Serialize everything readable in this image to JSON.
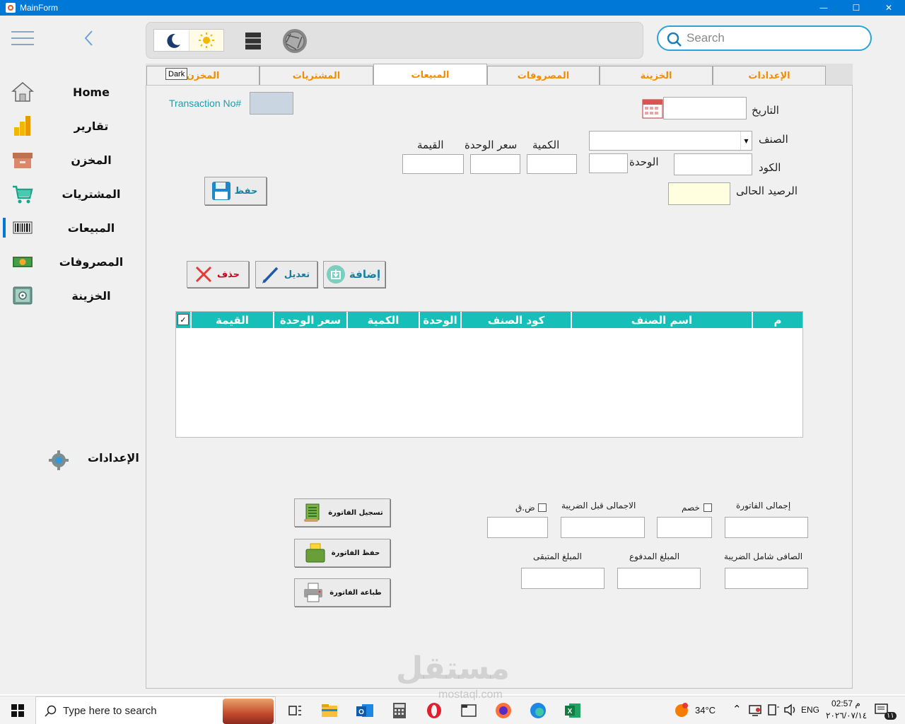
{
  "window": {
    "title": "MainForm",
    "controls": {
      "minimize": "—",
      "maximize": "☐",
      "close": "✕"
    }
  },
  "sidebar": {
    "items": [
      {
        "label": "Home",
        "icon": "home-icon"
      },
      {
        "label": "تقارير",
        "icon": "reports-chart-icon"
      },
      {
        "label": "المخزن",
        "icon": "storage-box-icon"
      },
      {
        "label": "المشتريات",
        "icon": "cart-icon"
      },
      {
        "label": "المبيعات",
        "icon": "barcode-icon",
        "active": true
      },
      {
        "label": "المصروفات",
        "icon": "money-icon"
      },
      {
        "label": "الخزينة",
        "icon": "safe-icon"
      }
    ],
    "settings_label": "الإعدادات"
  },
  "search": {
    "placeholder": "Search"
  },
  "tabs": [
    {
      "label": "الإعدادات"
    },
    {
      "label": "الخزينة"
    },
    {
      "label": "المصروفات"
    },
    {
      "label": "المبيعات",
      "active": true
    },
    {
      "label": "المشتريات"
    },
    {
      "label": "المخزن"
    }
  ],
  "tooltip": {
    "dark": "Dark"
  },
  "form": {
    "transaction_label": "Transaction No#",
    "date_label": "التاريخ",
    "item_label": "الصنف",
    "code_label": "الكود",
    "unit_label": "الوحدة",
    "qty_label": "الكمية",
    "unit_price_label": "سعر الوحدة",
    "value_label": "القيمة",
    "balance_label": "الرصيد الحالى",
    "save_button": "حفظ"
  },
  "actions": {
    "add": "إضافة",
    "edit": "تعديل",
    "delete": "حذف"
  },
  "grid": {
    "columns": [
      "م",
      "اسم الصنف",
      "كود الصنف",
      "الوحدة",
      "الكمية",
      "سعر الوحدة",
      "القيمة"
    ],
    "check_mark": "✓"
  },
  "totals": {
    "invoice_total": "إجمالى الفاتورة",
    "discount": "خصم",
    "before_tax": "الاجمالى قبل الضريبة",
    "vat": "ض.ق",
    "net_with_tax": "الصافى شامل الضريبة",
    "paid": "المبلغ المدفوع",
    "remaining": "المبلغ المتبقى"
  },
  "invoice_buttons": {
    "register": "تسجيل الفاتورة",
    "save": "حفظ الفاتورة",
    "print": "طباعة الفاتورة"
  },
  "watermark": {
    "main": "مستقل",
    "sub": "mostaql.com"
  },
  "taskbar": {
    "search_placeholder": "Type here to search",
    "weather": "34°C",
    "lang": "ENG",
    "time": "02:57 م",
    "date": "٢٠٢٦/٠٧/١٤",
    "notification_count": "١١"
  },
  "colors": {
    "accent": "#0078d7",
    "tab_text": "#f28c00",
    "grid_header": "#16c0b8",
    "transaction_text": "#1b9eae",
    "balance_bg": "#ffffe0"
  }
}
